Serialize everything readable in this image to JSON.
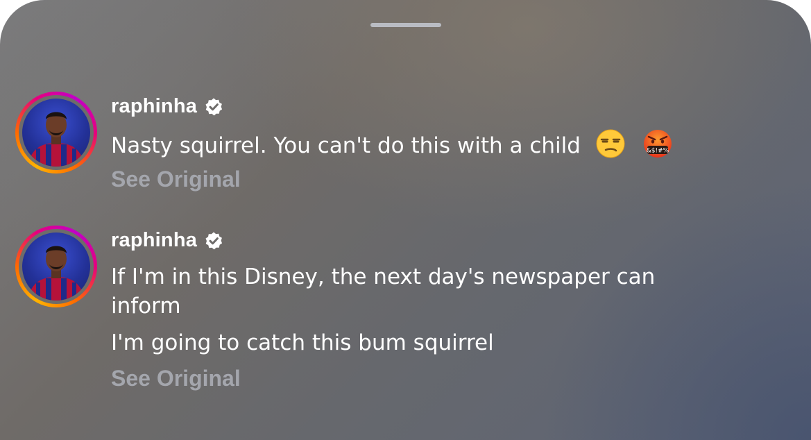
{
  "sheet": {
    "grabber_icon": "drag-handle"
  },
  "comments": [
    {
      "username": "raphinha",
      "verified_icon": "verified-badge-icon",
      "lines": [
        "Nasty squirrel. You can't do this with a child"
      ],
      "emojis": [
        "unamused-face",
        "face-with-symbols-on-mouth"
      ],
      "emoji_symbols": "&$!#%",
      "see_original": "See Original"
    },
    {
      "username": "raphinha",
      "verified_icon": "verified-badge-icon",
      "lines": [
        "If I'm in this Disney, the next day's newspaper can",
        "inform",
        "I'm going to catch this bum squirrel"
      ],
      "see_original": "See Original"
    }
  ],
  "colors": {
    "story_ring": [
      "#ffb300",
      "#ff6a00",
      "#e6007e",
      "#c100c9"
    ],
    "see_original": "#a4a6ad",
    "text": "#ffffff"
  }
}
